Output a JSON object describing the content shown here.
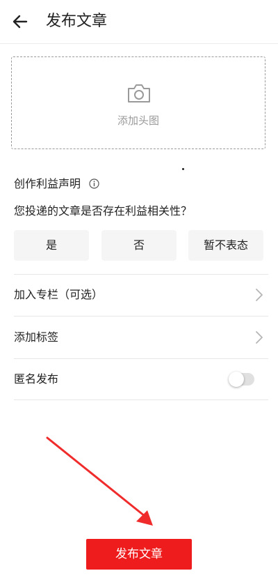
{
  "header": {
    "title": "发布文章",
    "back_icon": "arrow-left-icon"
  },
  "cover": {
    "label": "添加头图",
    "icon": "camera-icon"
  },
  "declaration": {
    "title": "创作利益声明",
    "info_icon": "info-icon",
    "question": "您投递的文章是否存在利益相关性？",
    "options": [
      "是",
      "否",
      "暂不表态"
    ]
  },
  "settings": {
    "column": {
      "label": "加入专栏（可选）",
      "icon": "chevron-right-icon"
    },
    "tags": {
      "label": "添加标签",
      "icon": "chevron-right-icon"
    },
    "anonymous": {
      "label": "匿名发布",
      "enabled": false
    }
  },
  "publish": {
    "label": "发布文章"
  },
  "colors": {
    "accent": "#ee1c1c",
    "annotation_arrow": "#f02b2b",
    "option_bg": "#f5f5f5"
  }
}
